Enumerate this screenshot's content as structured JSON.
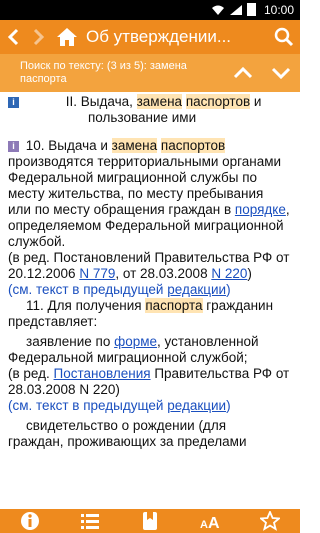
{
  "status": {
    "time": "10:00"
  },
  "toolbar": {
    "title": "Об утверждении..."
  },
  "search": {
    "text": "Поиск по тексту: (3 из 5): замена паспорта"
  },
  "content": {
    "section_pre": "II. Выдача, ",
    "section_hl1": "замена",
    "section_sp": " ",
    "section_hl2": "паспортов",
    "section_post1": " и",
    "section_post2": "пользование ими",
    "p10_num": "10. Выдача и ",
    "p10_hl1": "замена",
    "p10_sp": " ",
    "p10_hl2": "паспортов",
    "p10_l2": "производятся территориальными органами",
    "p10_l3": "Федеральной миграционной службы по",
    "p10_l4": "месту жительства, по месту пребывания",
    "p10_l5a": "или по месту обращения граждан в ",
    "p10_l5link": "порядке",
    "p10_l5b": ",",
    "p10_l6": "определяемом Федеральной миграционной",
    "p10_l7": "службой.",
    "red1_l1": "(в ред. Постановлений Правительства РФ от",
    "red1_l2a": "20.12.2006 ",
    "red1_link1": "N 779",
    "red1_l2b": ", от 28.03.2008 ",
    "red1_link2": "N 220",
    "red1_l2c": ")",
    "prev1_a": "(см. текст в предыдущей ",
    "prev1_link": "редакции",
    "prev1_b": ")",
    "p11_a": "11. Для получения ",
    "p11_hl": "паспорта",
    "p11_b": " гражданин",
    "p11_l2": "представляет:",
    "app_a": "заявление по ",
    "app_link": "форме",
    "app_b": ", установленной",
    "app_l2": "Федеральной миграционной службой;",
    "red2_a": "(в ред. ",
    "red2_link": "Постановления",
    "red2_b": " Правительства РФ от",
    "red2_l2": "28.03.2008 N 220)",
    "prev2_a": "(см. текст в предыдущей ",
    "prev2_link": "редакции",
    "prev2_b": ")",
    "birth_l1": "свидетельство о рождении (для",
    "birth_l2": "граждан, проживающих за пределами"
  },
  "icons": {
    "back": "chevron-left-icon",
    "forward": "chevron-right-icon",
    "home": "home-icon",
    "search": "search-icon",
    "up": "chevron-up-icon",
    "down": "chevron-down-icon",
    "info": "info-icon",
    "list": "list-icon",
    "bookmark": "bookmark-icon",
    "font": "font-size-icon",
    "star": "star-icon"
  },
  "colors": {
    "toolbar": "#ee8a1e",
    "searchbar": "#f3a33e",
    "highlight": "#ffe4b3",
    "link": "#1a4fbf"
  }
}
